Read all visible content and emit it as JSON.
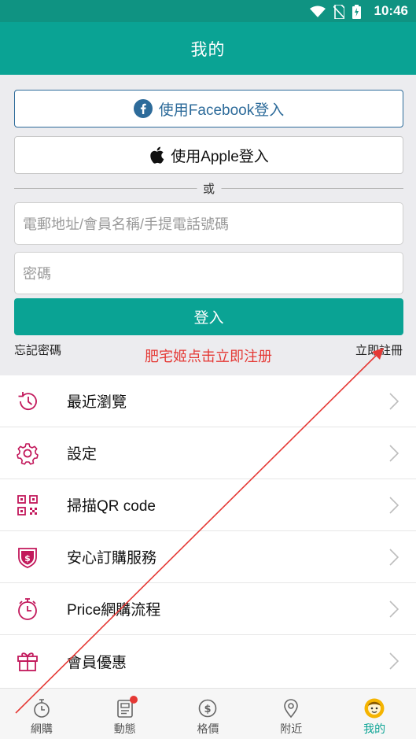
{
  "status_bar": {
    "time": "10:46"
  },
  "app_bar": {
    "title": "我的"
  },
  "login": {
    "facebook_button": "使用Facebook登入",
    "apple_button": "使用Apple登入",
    "divider_text": "或",
    "email_placeholder": "電郵地址/會員名稱/手提電話號碼",
    "password_placeholder": "密碼",
    "login_button": "登入",
    "forgot_password": "忘記密碼",
    "register": "立即註冊"
  },
  "annotation": {
    "text": "肥宅姬点击立即注册",
    "color": "#e53935"
  },
  "menu": {
    "items": [
      {
        "label": "最近瀏覽",
        "icon": "history-icon"
      },
      {
        "label": "設定",
        "icon": "gear-icon"
      },
      {
        "label": "掃描QR code",
        "icon": "qr-code-icon"
      },
      {
        "label": "安心訂購服務",
        "icon": "shield-dollar-icon"
      },
      {
        "label": "Price網購流程",
        "icon": "stopwatch-icon"
      },
      {
        "label": "會員優惠",
        "icon": "gift-icon"
      }
    ]
  },
  "tab_bar": {
    "tabs": [
      {
        "label": "網購",
        "icon": "stopwatch-icon",
        "active": false
      },
      {
        "label": "動態",
        "icon": "news-icon",
        "active": false,
        "badge": true
      },
      {
        "label": "格價",
        "icon": "dollar-compare-icon",
        "active": false
      },
      {
        "label": "附近",
        "icon": "location-pin-icon",
        "active": false
      },
      {
        "label": "我的",
        "icon": "avatar-icon",
        "active": true
      }
    ]
  },
  "colors": {
    "primary": "#0aa394",
    "status_bar": "#0f9382",
    "facebook": "#2d6b9a",
    "menu_icon": "#c2185b",
    "annotation": "#e53935"
  }
}
